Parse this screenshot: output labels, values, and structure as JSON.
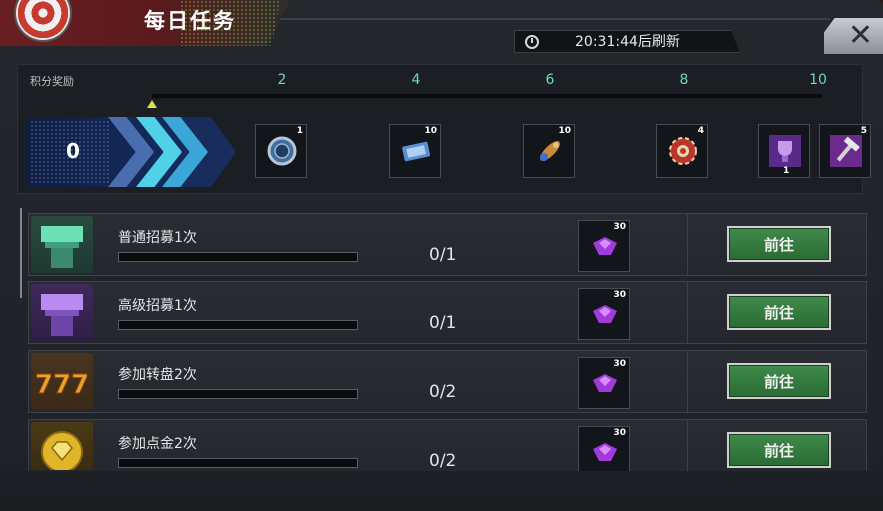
{
  "header": {
    "title": "每日任务",
    "timer_text": "20:31:44后刷新",
    "close_glyph": "✕"
  },
  "progress": {
    "label": "积分奖励",
    "current_points": "0",
    "ticks": [
      "2",
      "4",
      "6",
      "8",
      "10"
    ],
    "progress_fraction": 0,
    "rewards": [
      {
        "icon": "silver-coin-icon",
        "count": "1"
      },
      {
        "icon": "cinema-ticket-icon",
        "count": "10"
      },
      {
        "icon": "missile-icon",
        "count": "10"
      },
      {
        "icon": "casino-chip-icon",
        "count": "4"
      },
      {
        "icon": "purple-trophy-icon",
        "count": "1"
      },
      {
        "icon": "purple-hammer-icon",
        "count": "5"
      }
    ]
  },
  "tasks": [
    {
      "name": "普通招募1次",
      "progress": "0/1",
      "reward_count": "30",
      "button": "前往",
      "icon": "green-recruit-icon",
      "fill_fraction": 0
    },
    {
      "name": "高级招募1次",
      "progress": "0/1",
      "reward_count": "30",
      "button": "前往",
      "icon": "purple-recruit-icon",
      "fill_fraction": 0
    },
    {
      "name": "参加转盘2次",
      "progress": "0/2",
      "reward_count": "30",
      "button": "前往",
      "icon": "slot-777-icon",
      "fill_fraction": 0
    },
    {
      "name": "参加点金2次",
      "progress": "0/2",
      "reward_count": "30",
      "button": "前往",
      "icon": "gold-diamond-coin-icon",
      "fill_fraction": 0
    }
  ],
  "colors": {
    "accent_teal": "#6fd6c4",
    "button_green": "#2a6b34",
    "header_red": "#6a1f22"
  }
}
